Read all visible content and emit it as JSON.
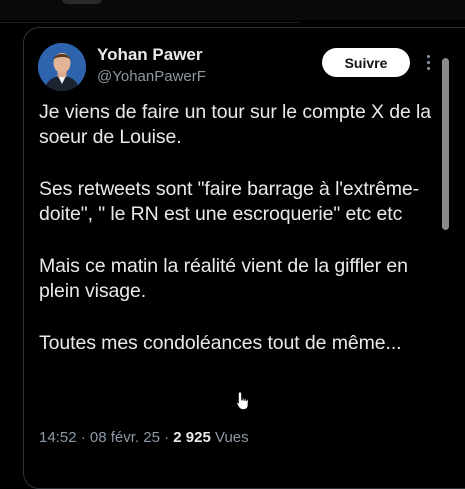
{
  "tweet": {
    "author_name": "Yohan Pawer",
    "author_handle": "@YohanPawerF",
    "follow_label": "Suivre",
    "paragraphs": [
      "Je viens de faire un tour sur le compte X de la soeur de Louise.",
      "Ses retweets sont \"faire barrage à l'extrême-doite\", \" le RN est une escroquerie\" etc etc",
      "Mais ce matin la réalité vient de la giffler en plein visage.",
      "Toutes mes condoléances tout de même..."
    ],
    "time": "14:52",
    "date": "08 févr. 25",
    "views_count": "2 925",
    "views_label": "Vues"
  },
  "colors": {
    "background": "#000000",
    "text": "#e7e9ea",
    "muted": "#8b98a5",
    "border": "#2f3336"
  },
  "icons": {
    "more": "more-vertical-icon",
    "cursor": "hand-pointer-icon"
  }
}
